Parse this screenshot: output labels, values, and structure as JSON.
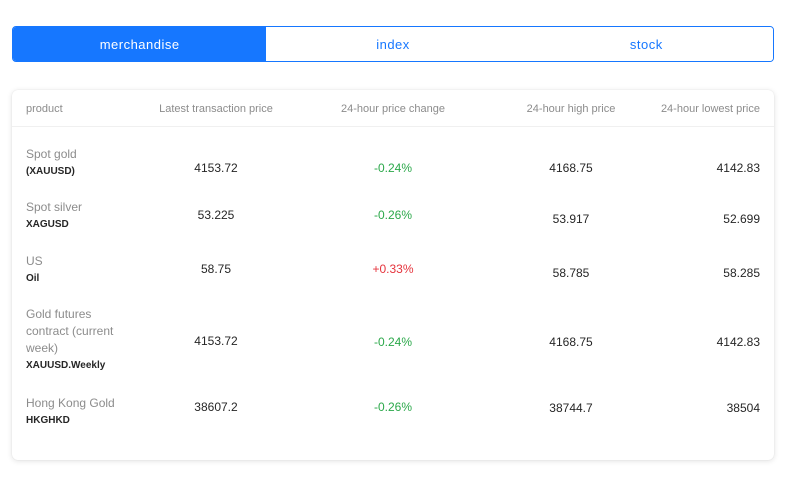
{
  "tabs": [
    {
      "label": "merchandise",
      "active": true
    },
    {
      "label": "index",
      "active": false
    },
    {
      "label": "stock",
      "active": false
    }
  ],
  "table": {
    "headers": {
      "product": "product",
      "last": "Latest transaction price",
      "change": "24-hour price change",
      "high": "24-hour high price",
      "low": "24-hour lowest price"
    },
    "rows": [
      {
        "name": "Spot gold",
        "code": "(XAUUSD)",
        "last": "4153.72",
        "change": "-0.24%",
        "high": "4168.75",
        "low": "4142.83"
      },
      {
        "name": "Spot silver",
        "code": "XAGUSD",
        "last": "53.225",
        "change": "-0.26%",
        "high": "53.917",
        "low": "52.699"
      },
      {
        "name": "US",
        "code": "Oil",
        "last": "58.75",
        "change": "+0.33%",
        "high": "58.785",
        "low": "58.285"
      },
      {
        "name": "Gold futures contract (current week)",
        "code": "XAUUSD.Weekly",
        "last": "4153.72",
        "change": "-0.24%",
        "high": "4168.75",
        "low": "4142.83"
      },
      {
        "name": "Hong Kong Gold",
        "code": "HKGHKD",
        "last": "38607.2",
        "change": "-0.26%",
        "high": "38744.7",
        "low": "38504"
      }
    ]
  },
  "colors": {
    "accent": "#1677ff",
    "down": "#2ba84a",
    "up": "#e5333c"
  }
}
